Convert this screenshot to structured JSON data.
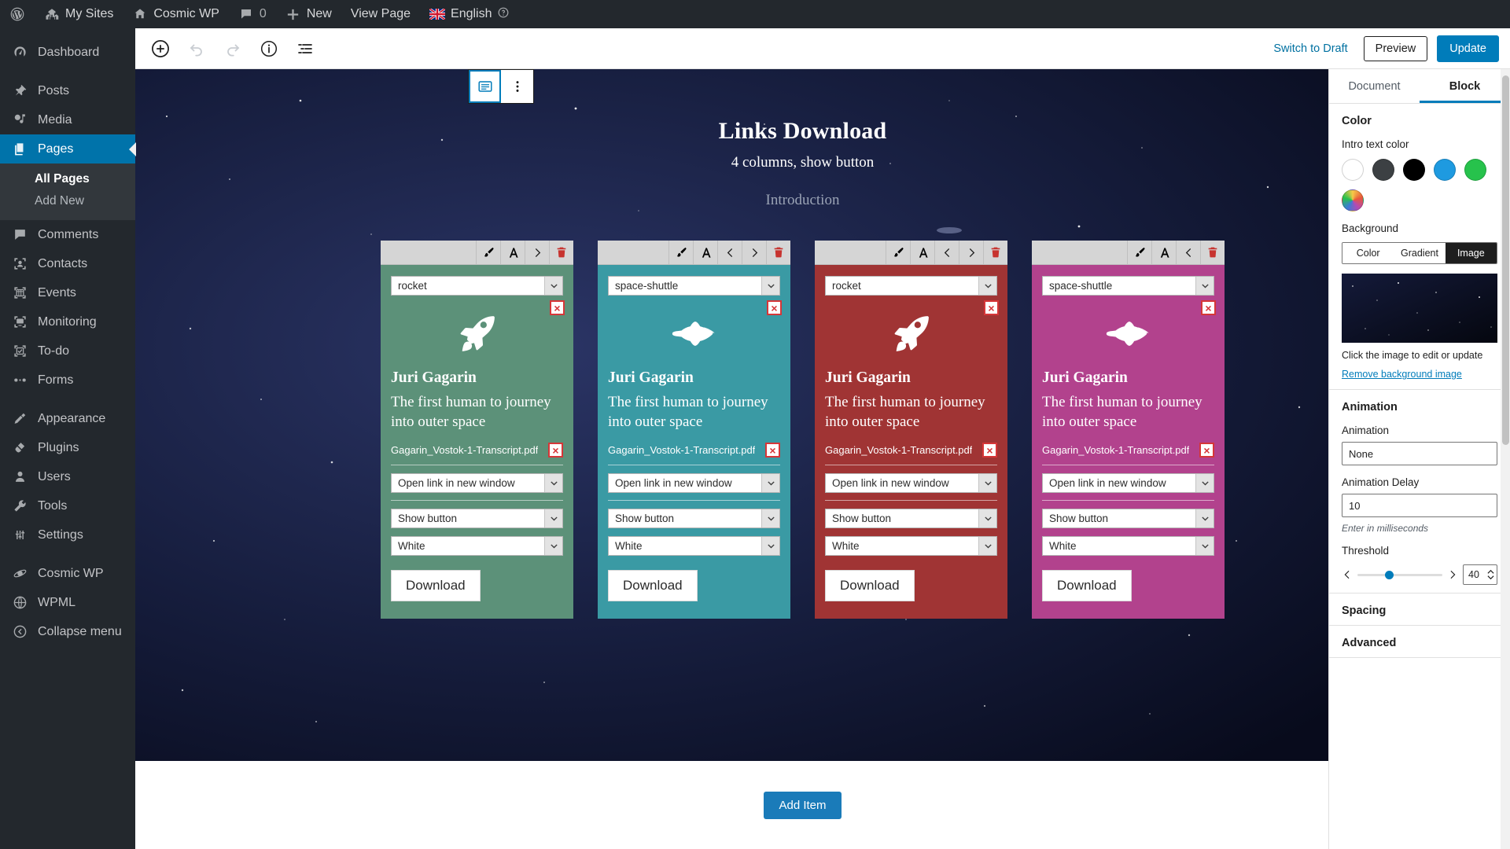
{
  "adminbar": {
    "items": [
      {
        "icon": "wordpress-logo-icon",
        "label": ""
      },
      {
        "icon": "sites-icon",
        "label": "My Sites"
      },
      {
        "icon": "home-icon",
        "label": "Cosmic WP"
      },
      {
        "icon": "comment-icon",
        "label": "0"
      },
      {
        "icon": "plus-icon",
        "label": "New"
      },
      {
        "icon": "",
        "label": "View Page"
      },
      {
        "icon": "flag-uk-icon",
        "label": "English"
      }
    ]
  },
  "adminmenu": {
    "items": [
      {
        "label": "Dashboard",
        "icon": "dashboard-icon",
        "current": false
      },
      {
        "label": "Posts",
        "icon": "pin-icon",
        "current": false
      },
      {
        "label": "Media",
        "icon": "media-icon",
        "current": false
      },
      {
        "label": "Pages",
        "icon": "pages-icon",
        "current": true
      },
      {
        "label": "Comments",
        "icon": "comment-icon",
        "current": false
      },
      {
        "label": "Contacts",
        "icon": "contacts-icon",
        "current": false
      },
      {
        "label": "Events",
        "icon": "events-icon",
        "current": false
      },
      {
        "label": "Monitoring",
        "icon": "monitoring-icon",
        "current": false
      },
      {
        "label": "To-do",
        "icon": "todo-icon",
        "current": false
      },
      {
        "label": "Forms",
        "icon": "forms-icon",
        "current": false
      },
      {
        "label": "Appearance",
        "icon": "appearance-icon",
        "current": false
      },
      {
        "label": "Plugins",
        "icon": "plugins-icon",
        "current": false
      },
      {
        "label": "Users",
        "icon": "users-icon",
        "current": false
      },
      {
        "label": "Tools",
        "icon": "tools-icon",
        "current": false
      },
      {
        "label": "Settings",
        "icon": "settings-icon",
        "current": false
      },
      {
        "label": "Cosmic WP",
        "icon": "cosmic-icon",
        "current": false
      },
      {
        "label": "WPML",
        "icon": "wpml-icon",
        "current": false
      },
      {
        "label": "Collapse menu",
        "icon": "collapse-icon",
        "current": false
      }
    ],
    "submenu": [
      {
        "label": "All Pages",
        "active": true
      },
      {
        "label": "Add New",
        "active": false
      }
    ]
  },
  "editor_header": {
    "add_block": "add-block-icon",
    "undo": "undo-icon",
    "redo": "redo-icon",
    "details": "info-icon",
    "outline": "list-view-icon",
    "switch_to_draft": "Switch to Draft",
    "preview": "Preview",
    "update": "Update"
  },
  "hero": {
    "title": "Links Download",
    "subtitle": "4 columns, show button",
    "intro": "Introduction"
  },
  "block_toolbar": {
    "block_type_icon": "paragraph-block-icon",
    "more_options_icon": "more-options-icon"
  },
  "cards": [
    {
      "color": "#5c9179",
      "icon_select": "rocket",
      "icon": "rocket-icon",
      "name": "Juri Gagarin",
      "desc": "The first human to journey into outer space",
      "file": "Gagarin_Vostok-1-Transcript.pdf",
      "link_target": "Open link in new window",
      "display_mode": "Show button",
      "button_color": "White",
      "button_label": "Download"
    },
    {
      "color": "#3a9aa4",
      "icon_select": "space-shuttle",
      "icon": "space-shuttle-icon",
      "name": "Juri Gagarin",
      "desc": "The first human to journey into outer space",
      "file": "Gagarin_Vostok-1-Transcript.pdf",
      "link_target": "Open link in new window",
      "display_mode": "Show button",
      "button_color": "White",
      "button_label": "Download"
    },
    {
      "color": "#a03434",
      "icon_select": "rocket",
      "icon": "rocket-icon",
      "name": "Juri Gagarin",
      "desc": "The first human to journey into outer space",
      "file": "Gagarin_Vostok-1-Transcript.pdf",
      "link_target": "Open link in new window",
      "display_mode": "Show button",
      "button_color": "White",
      "button_label": "Download"
    },
    {
      "color": "#b2428d",
      "icon_select": "space-shuttle",
      "icon": "space-shuttle-icon",
      "name": "Juri Gagarin",
      "desc": "The first human to journey into outer space",
      "file": "Gagarin_Vostok-1-Transcript.pdf",
      "link_target": "Open link in new window",
      "display_mode": "Show button",
      "button_color": "White",
      "button_label": "Download"
    }
  ],
  "card_tools": {
    "brush": "brush-icon",
    "text": "text-format-icon",
    "prev": "chevron-left-icon",
    "next": "chevron-right-icon",
    "delete": "trash-icon",
    "remove_x": "×"
  },
  "canvas_footer": {
    "add_item": "Add Item"
  },
  "sidebar": {
    "tabs": [
      {
        "label": "Document",
        "active": false
      },
      {
        "label": "Block",
        "active": true
      }
    ],
    "color": {
      "heading": "Color",
      "intro_text_label": "Intro text color",
      "swatches": [
        "#ffffff",
        "#3c4043",
        "#000000",
        "#1e9ae0",
        "#27c24c",
        "#f0a91e"
      ],
      "background_label": "Background",
      "bg_tabs": [
        {
          "label": "Color",
          "active": false
        },
        {
          "label": "Gradient",
          "active": false
        },
        {
          "label": "Image",
          "active": true
        }
      ],
      "bg_note": "Click the image to edit or update",
      "remove_bg": "Remove background image"
    },
    "animation": {
      "heading": "Animation",
      "label": "Animation",
      "value": "None",
      "delay_label": "Animation Delay",
      "delay_value": "10",
      "delay_help": "Enter in milliseconds",
      "threshold_label": "Threshold",
      "threshold_value": "40"
    },
    "spacing": {
      "heading": "Spacing"
    },
    "advanced": {
      "heading": "Advanced"
    }
  }
}
